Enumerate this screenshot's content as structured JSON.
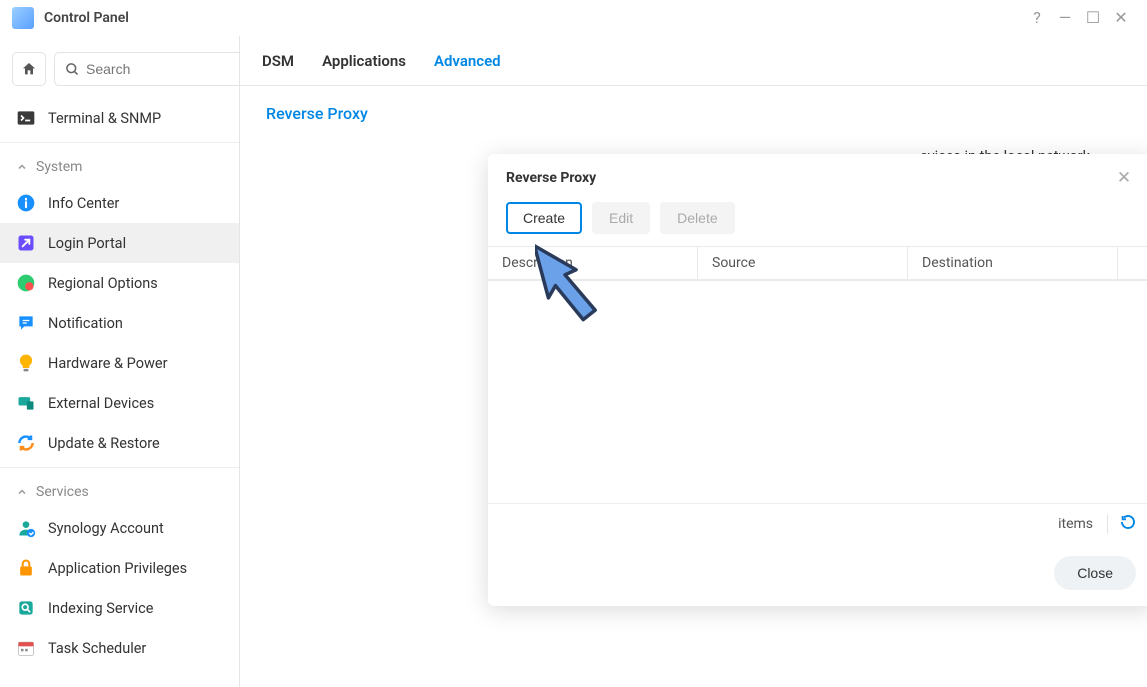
{
  "titlebar": {
    "title": "Control Panel"
  },
  "search": {
    "placeholder": "Search"
  },
  "sidebar": {
    "pinned": {
      "label": "Terminal & SNMP"
    },
    "sections": [
      {
        "title": "System",
        "items": [
          {
            "id": "info-center",
            "label": "Info Center"
          },
          {
            "id": "login-portal",
            "label": "Login Portal",
            "active": true
          },
          {
            "id": "regional-options",
            "label": "Regional Options"
          },
          {
            "id": "notification",
            "label": "Notification"
          },
          {
            "id": "hardware-power",
            "label": "Hardware & Power"
          },
          {
            "id": "external-devices",
            "label": "External Devices"
          },
          {
            "id": "update-restore",
            "label": "Update & Restore"
          }
        ]
      },
      {
        "title": "Services",
        "items": [
          {
            "id": "synology-account",
            "label": "Synology Account"
          },
          {
            "id": "application-privileges",
            "label": "Application Privileges"
          },
          {
            "id": "indexing-service",
            "label": "Indexing Service"
          },
          {
            "id": "task-scheduler",
            "label": "Task Scheduler"
          }
        ]
      }
    ]
  },
  "tabs": {
    "dsm": "DSM",
    "applications": "Applications",
    "advanced": "Advanced"
  },
  "page": {
    "section_title": "Reverse Proxy",
    "hint_fragment": "evices in the local network."
  },
  "dialog": {
    "title": "Reverse Proxy",
    "buttons": {
      "create": "Create",
      "edit": "Edit",
      "delete": "Delete",
      "close": "Close"
    },
    "columns": {
      "description": "Description",
      "source": "Source",
      "destination": "Destination"
    },
    "status": {
      "items_label": "items"
    }
  }
}
